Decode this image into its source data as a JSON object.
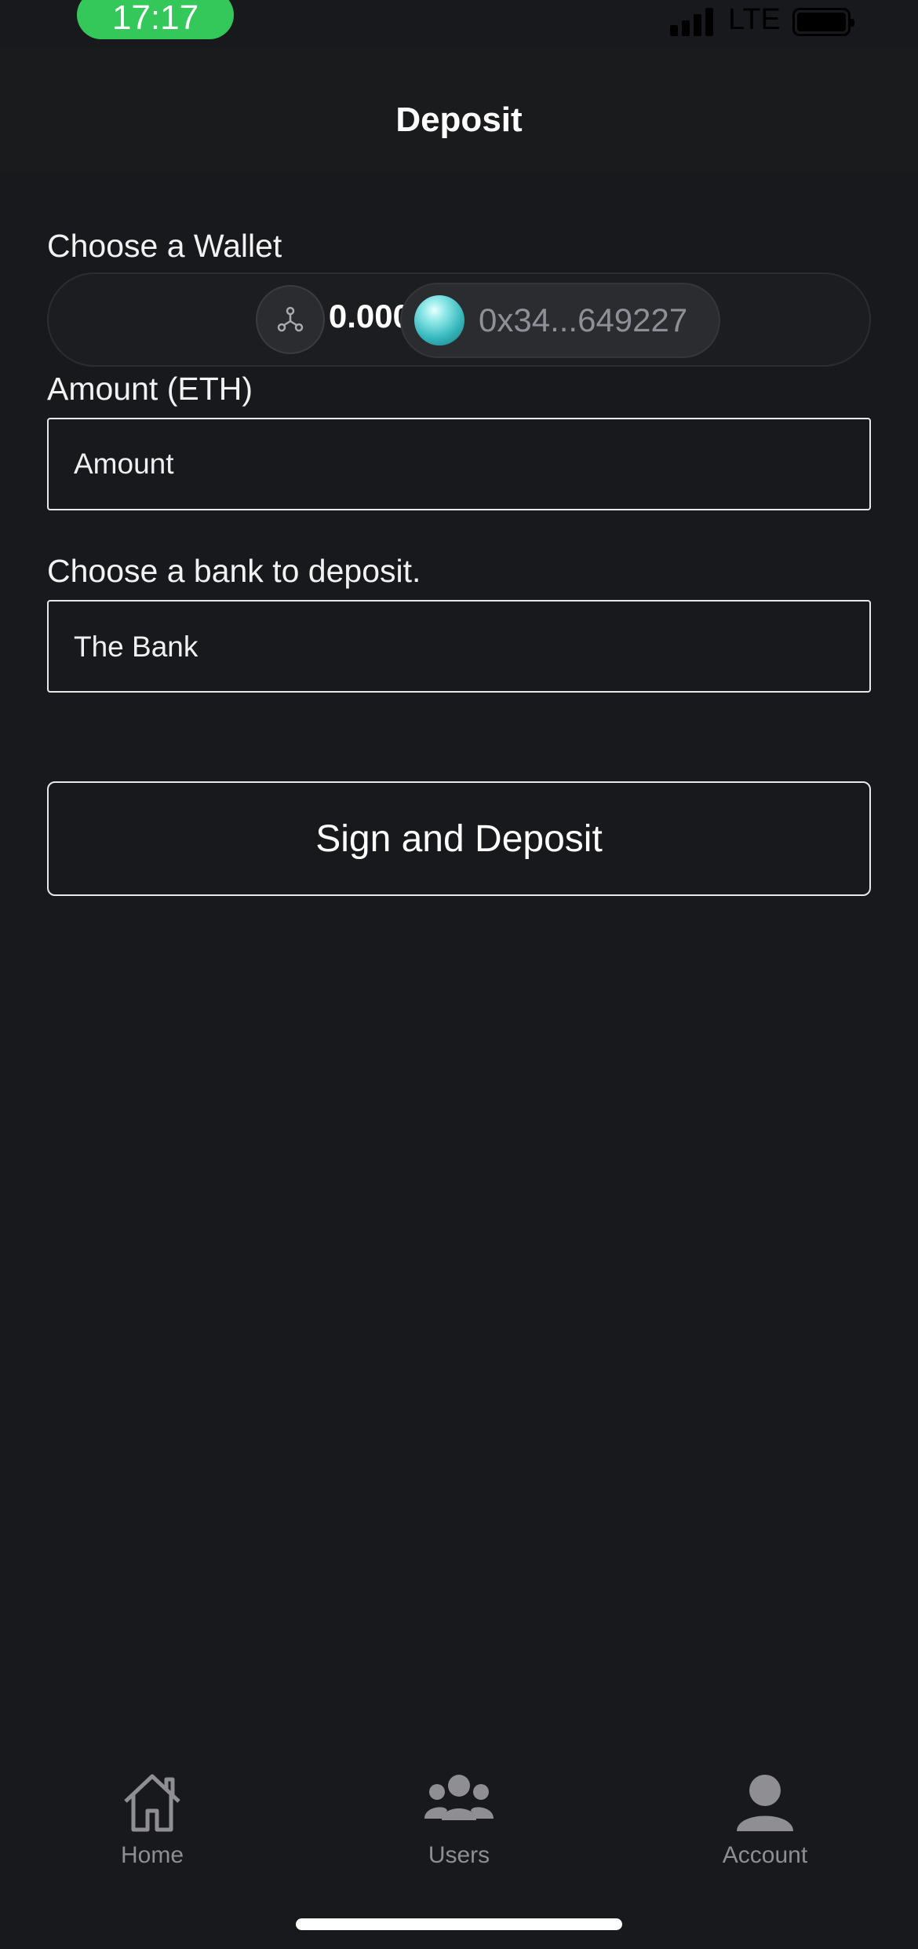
{
  "status_bar": {
    "time": "17:17",
    "network": "LTE"
  },
  "header": {
    "title": "Deposit"
  },
  "wallet": {
    "label": "Choose a Wallet",
    "balance": "0.000",
    "address": "0x34...649227"
  },
  "amount": {
    "label": "Amount (ETH)",
    "placeholder": "Amount",
    "value": ""
  },
  "bank": {
    "label": "Choose a bank to deposit.",
    "selected": "The Bank"
  },
  "actions": {
    "submit_label": "Sign and Deposit"
  },
  "tab_bar": {
    "items": [
      {
        "label": "Home",
        "icon": "home-icon"
      },
      {
        "label": "Users",
        "icon": "users-icon"
      },
      {
        "label": "Account",
        "icon": "account-icon"
      }
    ]
  },
  "colors": {
    "background": "#18191c",
    "time_pill": "#34c759",
    "tab_inactive": "#8e8e93",
    "address_text": "#8d9096"
  }
}
